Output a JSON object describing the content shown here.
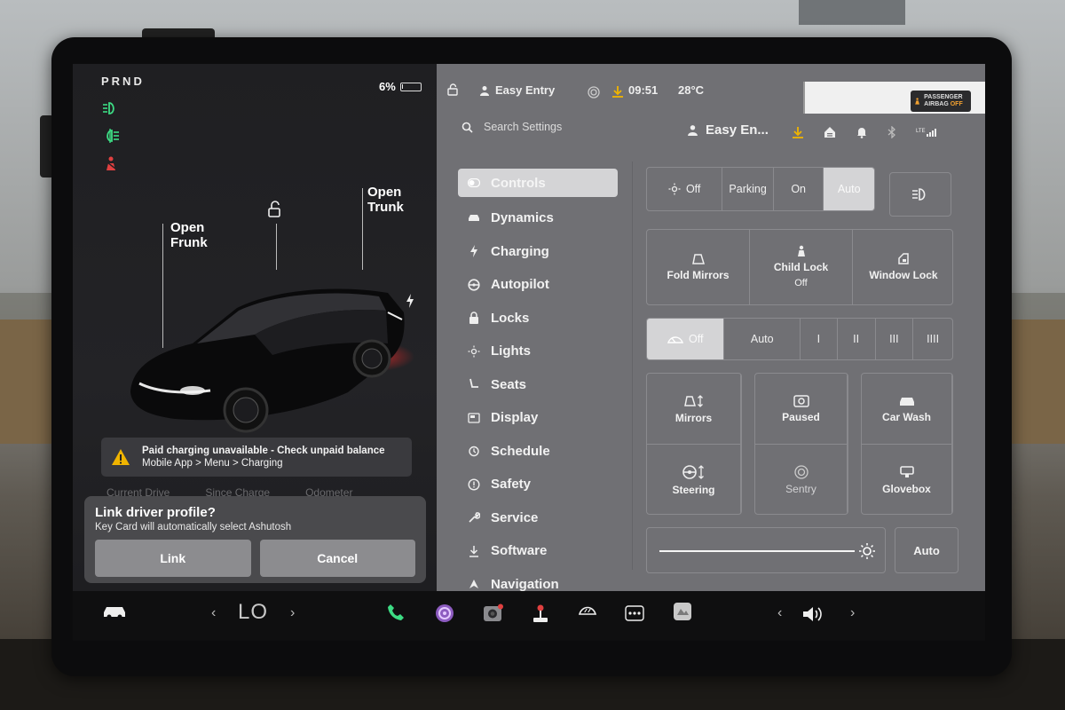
{
  "status": {
    "gear": "PRND",
    "battery_percent": "6%",
    "battery_level": 0.06,
    "profile": "Easy Entry",
    "time": "09:51",
    "temperature": "28°C",
    "airbag_label": "PASSENGER AIRBAG",
    "airbag_state": "OFF"
  },
  "car_view": {
    "frunk_label": "Open Frunk",
    "trunk_label": "Open Trunk",
    "alert_line1": "Paid charging unavailable - Check unpaid balance",
    "alert_line2": "Mobile App > Menu > Charging",
    "stats_peek": [
      "Current Drive",
      "Since Charge",
      "Odometer"
    ]
  },
  "dialog": {
    "title": "Link driver profile?",
    "subtitle": "Key Card will automatically select Ashutosh",
    "link_label": "Link",
    "cancel_label": "Cancel"
  },
  "settings_header": {
    "search_placeholder": "Search Settings",
    "profile_short": "Easy En...",
    "lte": "LTE"
  },
  "nav": [
    {
      "label": "Controls",
      "icon": "toggle-icon",
      "active": true
    },
    {
      "label": "Dynamics",
      "icon": "car-icon"
    },
    {
      "label": "Charging",
      "icon": "bolt-icon"
    },
    {
      "label": "Autopilot",
      "icon": "steering-wheel-icon"
    },
    {
      "label": "Locks",
      "icon": "lock-icon"
    },
    {
      "label": "Lights",
      "icon": "light-icon"
    },
    {
      "label": "Seats",
      "icon": "seat-icon"
    },
    {
      "label": "Display",
      "icon": "display-icon"
    },
    {
      "label": "Schedule",
      "icon": "clock-icon"
    },
    {
      "label": "Safety",
      "icon": "info-icon"
    },
    {
      "label": "Service",
      "icon": "wrench-icon"
    },
    {
      "label": "Software",
      "icon": "download-icon"
    },
    {
      "label": "Navigation",
      "icon": "navigation-icon"
    }
  ],
  "headlights": {
    "options": [
      "Off",
      "Parking",
      "On",
      "Auto"
    ],
    "selected": "Auto"
  },
  "quick_controls": {
    "fold_mirrors": "Fold Mirrors",
    "child_lock": "Child Lock",
    "child_lock_state": "Off",
    "window_lock": "Window Lock"
  },
  "wipers": {
    "options": [
      "Off",
      "Auto",
      "I",
      "II",
      "III",
      "IIII"
    ],
    "selected": "Off"
  },
  "tiles": {
    "mirrors": "Mirrors",
    "paused": "Paused",
    "car_wash": "Car Wash",
    "steering": "Steering",
    "sentry": "Sentry",
    "glovebox": "Glovebox"
  },
  "brightness": {
    "level": 0.95,
    "auto_label": "Auto"
  },
  "dock": {
    "temperature": "LO"
  },
  "colors": {
    "settings_bg": "#707074",
    "active_bg": "#d4d4d6",
    "indicator_green": "#3ddc84",
    "seatbelt_red": "#e04040",
    "alert_amber": "#f0b400"
  }
}
